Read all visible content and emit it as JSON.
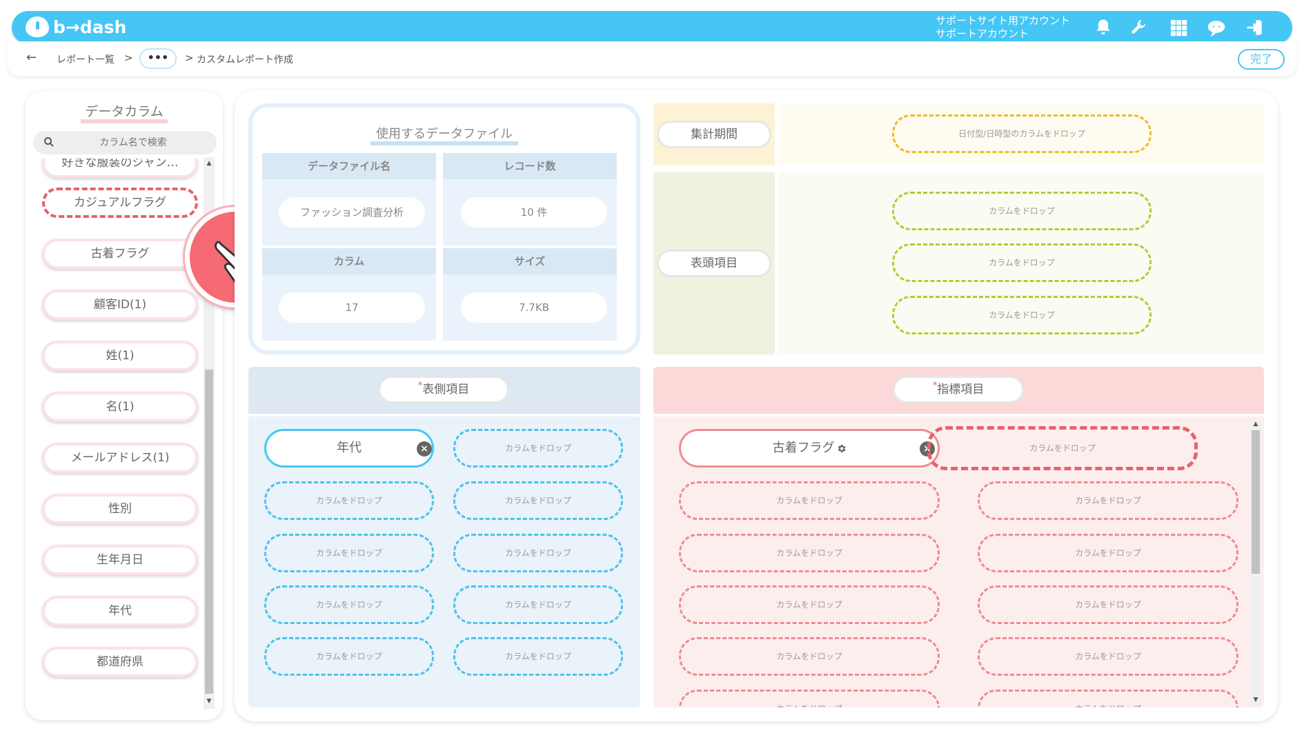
{
  "header": {
    "logo_text": "b→dash",
    "account_line1": "サポートサイト用アカウント",
    "account_line2": "サポートアカウント",
    "icons": [
      "bell-icon",
      "wrench-icon",
      "grid-icon",
      "chat-bot-icon",
      "logout-icon"
    ]
  },
  "breadcrumb": {
    "back": "←",
    "item1": "レポート一覧",
    "sep": ">",
    "more": "•••",
    "current": "カスタムレポート作成",
    "done_label": "完了"
  },
  "left_panel": {
    "title": "データカラム",
    "search_placeholder": "カラム名で検索",
    "columns": [
      "好きな服装のジャン…",
      "カジュアルフラグ",
      "古着フラグ",
      "顧客ID(1)",
      "姓(1)",
      "名(1)",
      "メールアドレス(1)",
      "性別",
      "生年月日",
      "年代",
      "都道府県"
    ],
    "active_column": "カジュアルフラグ"
  },
  "data_file": {
    "title": "使用するデータファイル",
    "file_name_label": "データファイル名",
    "file_name": "ファッション調査分析",
    "record_label": "レコード数",
    "record_value": "10 件",
    "column_label": "カラム",
    "column_value": "17",
    "size_label": "サイズ",
    "size_value": "7.7KB"
  },
  "period": {
    "label": "集計期間",
    "drop_text": "日付型/日時型のカラムをドロップ"
  },
  "header_items": {
    "label": "表頭項目",
    "drop_text": "カラムをドロップ"
  },
  "side_items": {
    "required_mark": "*",
    "label": "表側項目",
    "chip": "年代",
    "drop_text": "カラムをドロップ"
  },
  "metric_items": {
    "required_mark": "*",
    "label": "指標項目",
    "chip": "古着フラグ",
    "drop_text": "カラムをドロップ"
  },
  "colors": {
    "brand": "#45c6f5",
    "accent_red": "#e9616b",
    "drop_yellow": "#f1b92a",
    "drop_green": "#b1cc33",
    "drop_blue": "#4cc3ea",
    "drop_red": "#f08b90"
  }
}
